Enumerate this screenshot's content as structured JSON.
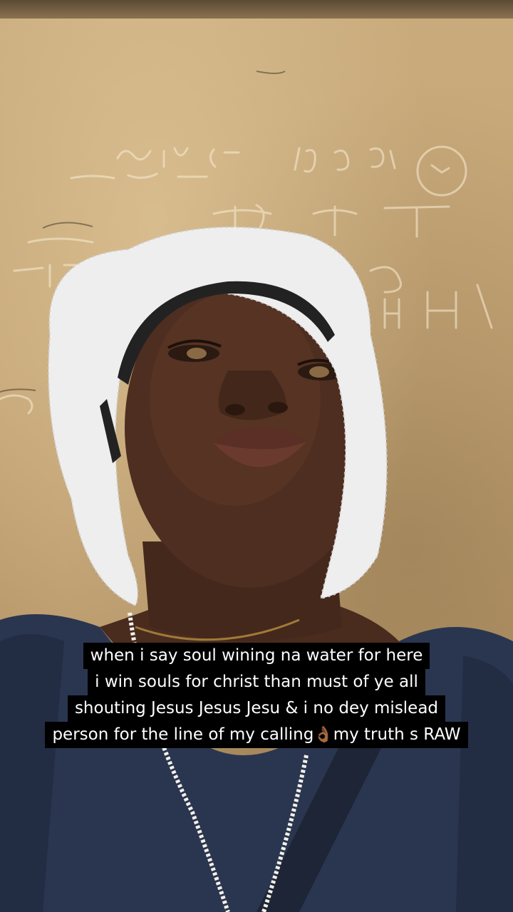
{
  "caption": {
    "lines": [
      "when i say soul wining na water for here",
      "i win souls for christ than must of ye all",
      "shouting Jesus Jesus Jesu & i no dey mislead"
    ],
    "last_line_before_emoji": "person for the line of my calling",
    "emoji": "👌🏾",
    "emoji_name": "ok-hand-emoji",
    "last_line_after_emoji": "my truth s RAW"
  },
  "colors": {
    "caption_background": "#000000",
    "caption_text": "#ffffff",
    "wall": "#c4a576",
    "shirt": "#2a3650",
    "bonnet": "#f2f2f2"
  }
}
